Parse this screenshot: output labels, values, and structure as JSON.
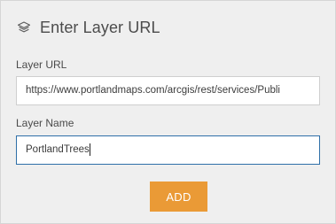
{
  "header": {
    "icon": "layers-icon",
    "title": "Enter Layer URL"
  },
  "layer_url": {
    "label": "Layer URL",
    "value": "https://www.portlandmaps.com/arcgis/rest/services/Publi"
  },
  "layer_name": {
    "label": "Layer Name",
    "value": "PortlandTrees"
  },
  "add_button": {
    "label": "ADD"
  },
  "colors": {
    "panel_bg": "#efefef",
    "accent_button": "#ea9a36",
    "focus_border": "#2f6fa8"
  }
}
